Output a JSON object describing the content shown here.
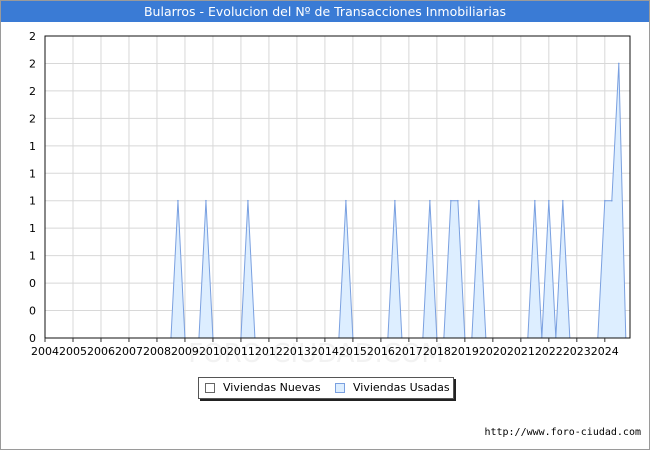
{
  "title": "Bularros - Evolucion del Nº de Transacciones Inmobiliarias",
  "footer": "http://www.foro-ciudad.com",
  "watermark": "FORO-CIUDAD.COM",
  "chart_data": {
    "type": "area",
    "title": "Bularros - Evolucion del Nº de Transacciones Inmobiliarias",
    "xlabel": "",
    "ylabel": "",
    "xlim": [
      2004,
      2024.9
    ],
    "ylim": [
      0,
      2.2
    ],
    "x_ticks": [
      "2004",
      "2005",
      "2006",
      "2007",
      "2008",
      "2009",
      "2010",
      "2011",
      "2012",
      "2013",
      "2014",
      "2015",
      "2016",
      "2017",
      "2018",
      "2019",
      "2020",
      "2021",
      "2022",
      "2023",
      "2024"
    ],
    "y_ticks": [
      {
        "value": 0,
        "label": "0"
      },
      {
        "value": 0.2,
        "label": "0"
      },
      {
        "value": 0.4,
        "label": "0"
      },
      {
        "value": 0.6,
        "label": "1"
      },
      {
        "value": 0.8,
        "label": "1"
      },
      {
        "value": 1.0,
        "label": "1"
      },
      {
        "value": 1.2,
        "label": "1"
      },
      {
        "value": 1.4,
        "label": "1"
      },
      {
        "value": 1.6,
        "label": "2"
      },
      {
        "value": 1.8,
        "label": "2"
      },
      {
        "value": 2.0,
        "label": "2"
      },
      {
        "value": 2.2,
        "label": "2"
      }
    ],
    "grid": true,
    "legend_position": "bottom",
    "series": [
      {
        "name": "Viviendas Nuevas",
        "color": "#ffffff",
        "edge": "#666666",
        "points": []
      },
      {
        "name": "Viviendas Usadas",
        "color": "#ddeeff",
        "edge": "#7aa0e0",
        "points": [
          [
            2008.5,
            0
          ],
          [
            2008.75,
            1
          ],
          [
            2009.0,
            0
          ],
          [
            2009.5,
            0
          ],
          [
            2009.75,
            1
          ],
          [
            2010.0,
            0
          ],
          [
            2011.0,
            0
          ],
          [
            2011.25,
            1
          ],
          [
            2011.5,
            0
          ],
          [
            2014.5,
            0
          ],
          [
            2014.75,
            1
          ],
          [
            2015.0,
            0
          ],
          [
            2016.25,
            0
          ],
          [
            2016.5,
            1
          ],
          [
            2016.75,
            0
          ],
          [
            2017.5,
            0
          ],
          [
            2017.75,
            1
          ],
          [
            2018.0,
            0
          ],
          [
            2018.25,
            0
          ],
          [
            2018.5,
            1
          ],
          [
            2018.75,
            1
          ],
          [
            2019.0,
            0
          ],
          [
            2019.25,
            0
          ],
          [
            2019.5,
            1
          ],
          [
            2019.75,
            0
          ],
          [
            2021.25,
            0
          ],
          [
            2021.5,
            1
          ],
          [
            2021.75,
            0
          ],
          [
            2021.75,
            0
          ],
          [
            2022.0,
            1
          ],
          [
            2022.25,
            0
          ],
          [
            2022.25,
            0
          ],
          [
            2022.5,
            1
          ],
          [
            2022.75,
            0
          ],
          [
            2023.75,
            0
          ],
          [
            2024.0,
            1
          ],
          [
            2024.25,
            1
          ],
          [
            2024.5,
            2
          ],
          [
            2024.75,
            0
          ]
        ]
      }
    ]
  }
}
